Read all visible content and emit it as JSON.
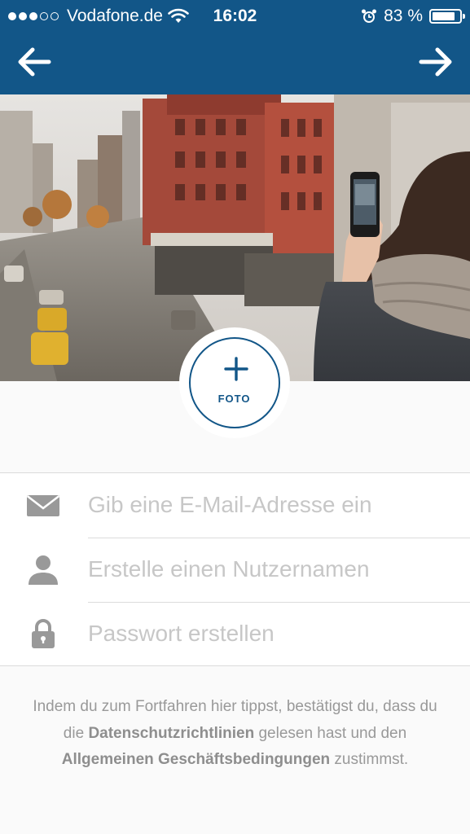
{
  "status_bar": {
    "carrier": "Vodafone.de",
    "time": "16:02",
    "battery_text": "83 %",
    "battery_level": 0.83,
    "signal_bars": 3,
    "signal_total": 5
  },
  "nav": {
    "back_icon": "arrow-left-icon",
    "next_icon": "arrow-right-icon"
  },
  "photo": {
    "label": "FOTO",
    "icon": "plus-icon"
  },
  "form": {
    "email_placeholder": "Gib eine E-Mail-Adresse ein",
    "username_placeholder": "Erstelle einen Nutzernamen",
    "password_placeholder": "Passwort erstellen"
  },
  "legal": {
    "part1": "Indem du zum Fortfahren hier tippst, bestätigst du, dass du die ",
    "privacy_link": "Datenschutzrichtlinien",
    "part2": " gelesen hast und den ",
    "terms_link": "Allgemeinen Geschäftsbedingungen",
    "part3": " zustimmst."
  },
  "colors": {
    "accent": "#125688",
    "placeholder": "#c7c7c7",
    "legal_text": "#999999",
    "background": "#fafafa"
  }
}
